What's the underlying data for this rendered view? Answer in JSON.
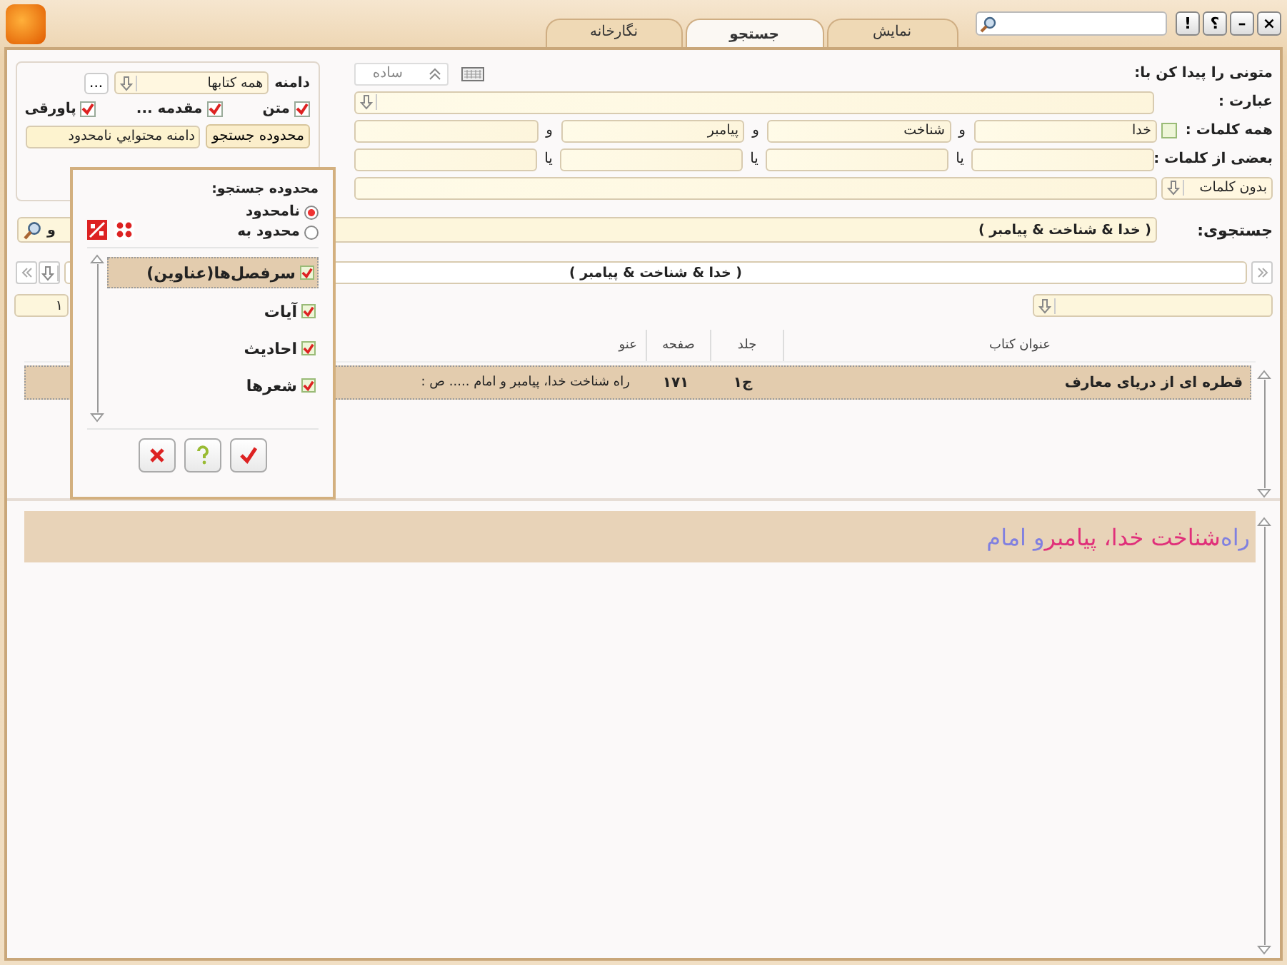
{
  "title_bar": {
    "tabs": [
      {
        "label": "نمایش",
        "selected": false
      },
      {
        "label": "جستجو",
        "selected": true
      },
      {
        "label": "نگارخانه",
        "selected": false
      }
    ],
    "window_buttons": [
      "×",
      "–",
      "؟",
      "!"
    ]
  },
  "search_form": {
    "heading": "متونی را پیدا کن با:",
    "mode_button": "ساده",
    "phrase": {
      "label": "عبارت :"
    },
    "all_words": {
      "label": "همه کلمات :",
      "checked": false,
      "words": [
        "خدا",
        "شناخت",
        "پیامبر"
      ],
      "connectors": [
        "و",
        "و",
        "و"
      ]
    },
    "some_words": {
      "label": "بعضی از کلمات :",
      "connectors": [
        "یا",
        "یا",
        "یا"
      ]
    },
    "exclude": {
      "mode": "بدون کلمات"
    }
  },
  "scope": {
    "label": "دامنه",
    "books": "همه کتابها",
    "more": "...",
    "parts": [
      {
        "label": "متن",
        "checked": true
      },
      {
        "label": "مقدمه ...",
        "checked": true
      },
      {
        "label": "پاورقی",
        "checked": true
      }
    ],
    "range_button": "محدوده جستجو",
    "range_value": "دامنه محتوايي نامحدود"
  },
  "query": {
    "label": "جستجوی:",
    "value": "( خدا & شناخت  & پیامبر )",
    "operator": "و"
  },
  "results": {
    "expression": "( خدا & شناخت  & پیامبر )",
    "page": "۱",
    "columns": [
      "عنوان کتاب",
      "جلد",
      "صفحه",
      "عنو"
    ],
    "rows": [
      {
        "cells": [
          "قطره ای از دریای معارف",
          "ج۱",
          "۱۷۱",
          "راه شناخت خدا، پیامبر و امام ..... ص :"
        ],
        "selected": true
      }
    ]
  },
  "preview": {
    "segments": [
      {
        "text": "راه",
        "color": "#8080e0"
      },
      {
        "text": "شناخت خدا، پیامبر",
        "color": "#e0307a"
      },
      {
        "text": "و امام",
        "color": "#8080e0"
      }
    ]
  },
  "popup": {
    "title": "محدوده جستجو:",
    "options": [
      {
        "label": "نامحدود",
        "selected": true
      },
      {
        "label": "محدود به",
        "selected": false
      }
    ],
    "items": [
      {
        "label": "سرفصل‌ها(عناوین)",
        "checked": true,
        "selected": true
      },
      {
        "label": "آیات",
        "checked": true,
        "selected": false
      },
      {
        "label": "احادیث",
        "checked": true,
        "selected": false
      },
      {
        "label": "شعرها",
        "checked": true,
        "selected": false
      }
    ]
  }
}
